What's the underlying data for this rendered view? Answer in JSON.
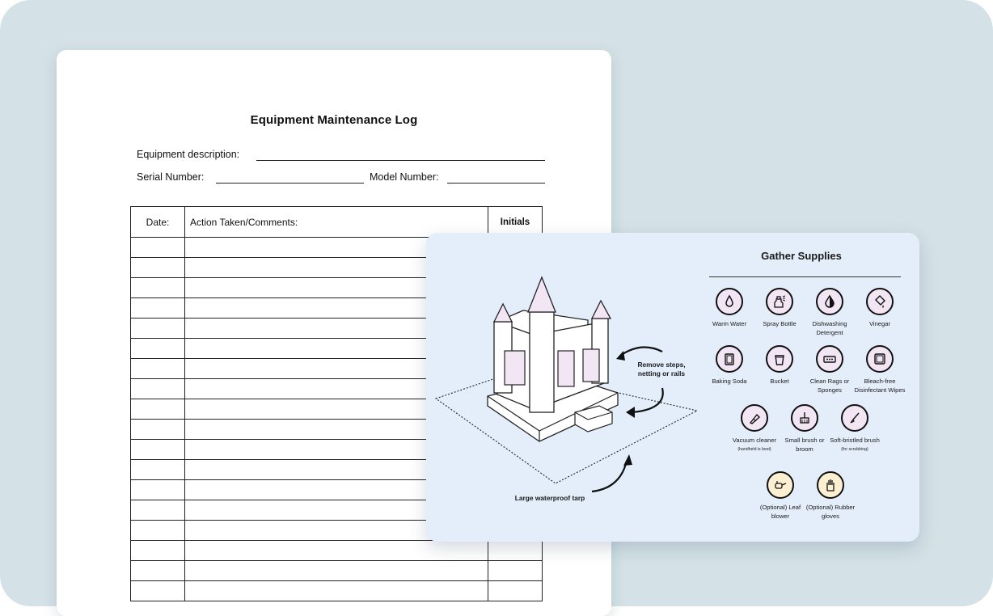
{
  "log_form": {
    "title": "Equipment Maintenance Log",
    "equipment_description_label": "Equipment description:",
    "serial_number_label": "Serial Number:",
    "model_number_label": "Model Number:",
    "columns": [
      "Date:",
      "Action Taken/Comments:",
      "Initials"
    ]
  },
  "supplies_card": {
    "title": "Gather Supplies",
    "items": [
      {
        "label": "Warm Water",
        "icon": "water-drop-icon"
      },
      {
        "label": "Spray Bottle",
        "icon": "spray-bottle-icon"
      },
      {
        "label": "Dishwashing Detergent",
        "icon": "detergent-icon"
      },
      {
        "label": "Vinegar",
        "icon": "vinegar-icon"
      },
      {
        "label": "Baking Soda",
        "icon": "baking-soda-icon"
      },
      {
        "label": "Bucket",
        "icon": "bucket-icon"
      },
      {
        "label": "Clean Rags or Sponges",
        "icon": "sponge-icon"
      },
      {
        "label": "Bleach-free Disinfectant Wipes",
        "icon": "wipes-icon"
      },
      {
        "label": "Vacuum cleaner",
        "note": "(handheld is best)",
        "icon": "vacuum-icon"
      },
      {
        "label": "Small brush or broom",
        "icon": "broom-icon"
      },
      {
        "label": "Soft-bristled brush",
        "note": "(for scrubbing)",
        "icon": "brush-icon"
      },
      {
        "label": "(Optional) Leaf blower",
        "icon": "leaf-blower-icon"
      },
      {
        "label": "(Optional) Rubber gloves",
        "icon": "glove-icon"
      }
    ],
    "callouts": {
      "remove": "Remove steps, netting or rails",
      "tarp": "Large waterproof tarp"
    },
    "colors": {
      "icon_fill": "#f3e6f4",
      "optional_fill": "#fdf0d2",
      "card_bg": "#e3eefa"
    }
  }
}
